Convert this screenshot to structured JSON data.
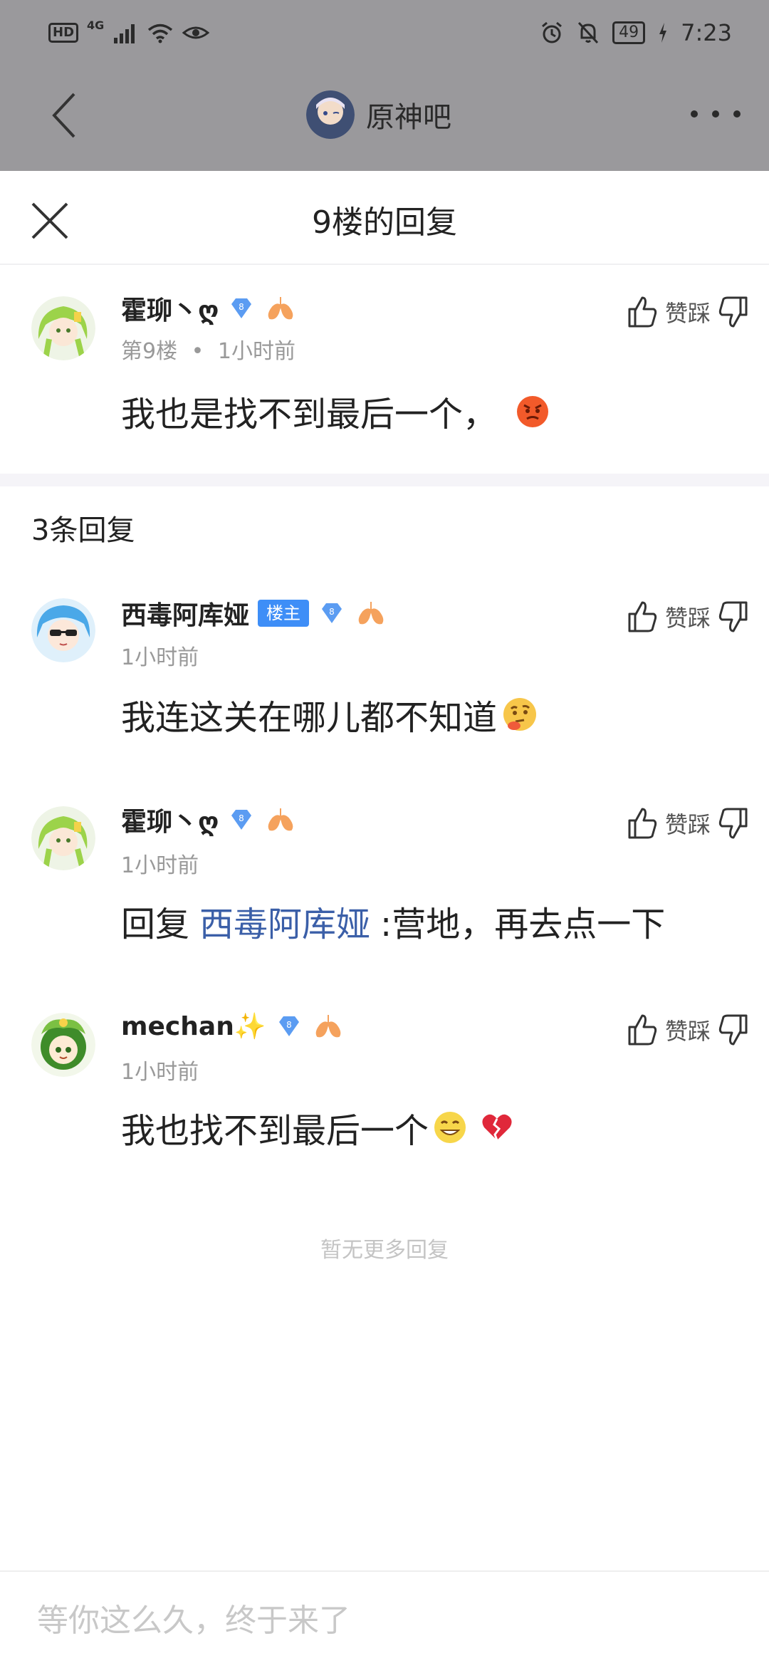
{
  "status_bar": {
    "hd": "HD",
    "network": "4G",
    "battery": "49",
    "time": "7:23"
  },
  "forum": {
    "name": "原神吧"
  },
  "panel": {
    "title": "9楼的回复"
  },
  "main_post": {
    "username": "霍珋丶ღ",
    "level_badge": "8",
    "floor": "第9楼",
    "separator": "•",
    "time": "1小时前",
    "text": "我也是找不到最后一个，",
    "vote_label": "赞踩"
  },
  "reply_count": "3条回复",
  "replies": [
    {
      "username": "西毒阿库娅",
      "host_badge": "楼主",
      "level_badge": "8",
      "time": "1小时前",
      "text": "我连这关在哪儿都不知道",
      "vote_label": "赞踩"
    },
    {
      "username": "霍珋丶ღ",
      "level_badge": "8",
      "time": "1小时前",
      "reply_prefix": "回复",
      "mention": "西毒阿库娅",
      "text": ":营地，再去点一下",
      "vote_label": "赞踩"
    },
    {
      "username": "mechan",
      "username_suffix": "✨",
      "level_badge": "8",
      "time": "1小时前",
      "text": "我也找不到最后一个",
      "vote_label": "赞踩"
    }
  ],
  "no_more": "暂无更多回复",
  "input": {
    "placeholder": "等你这么久，终于来了"
  },
  "colors": {
    "dim_overlay": "#9a999c",
    "host_badge": "#3e8ef7",
    "mention": "#3b5fa8",
    "level_badge": "#5b9cf2",
    "lung_badge": "#f5a25d"
  }
}
